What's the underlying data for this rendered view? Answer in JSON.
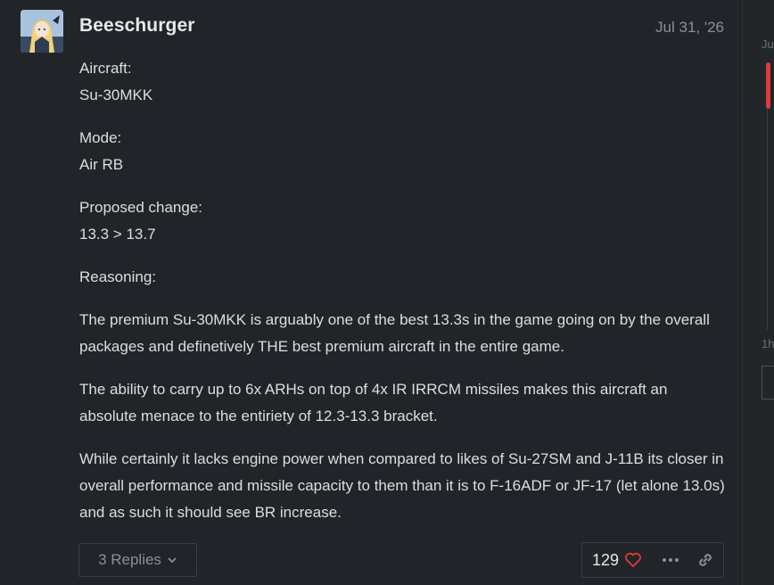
{
  "post": {
    "username": "Beeschurger",
    "date": "Jul 31, '26",
    "avatar_icon": "anime-character-avatar",
    "paragraphs": [
      [
        "Aircraft:",
        "Su-30MKK"
      ],
      [
        "Mode:",
        "Air RB"
      ],
      [
        "Proposed change:",
        "13.3 > 13.7"
      ],
      [
        "Reasoning:"
      ],
      [
        "The premium Su-30MKK is arguably one of the best 13.3s in the game going on by the overall packages and definetively THE best premium aircraft in the entire game."
      ],
      [
        "The ability to carry up to 6x ARHs on top of 4x IR IRRCM missiles makes this aircraft an absolute menace to the entiriety of 12.3-13.3 bracket."
      ],
      [
        "While certainly it lacks engine power when compared to likes of Su-27SM and J-11B its closer in overall performance and missile capacity to them than it is to F-16ADF or JF-17 (let alone 13.0s) and as such it should see BR increase."
      ]
    ],
    "replies_label": "3 Replies",
    "like_count": "129"
  },
  "sidebar": {
    "top_label": "Ju",
    "bottom_label": "1h"
  },
  "colors": {
    "background": "#212529",
    "text": "#dcdee0",
    "muted": "#8a9096",
    "heart": "#e0393e",
    "timeline_accent": "#e0393e"
  }
}
